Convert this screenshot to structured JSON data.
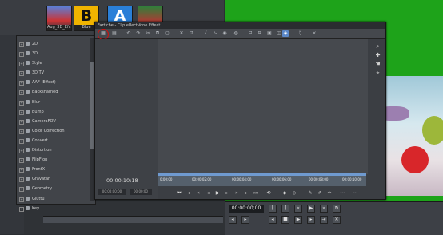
{
  "bin": {
    "thumbs": [
      {
        "caption": "Aug_3D_Efct..."
      },
      {
        "letter": "B",
        "caption": "Blue"
      },
      {
        "letter": "A",
        "caption": ""
      },
      {
        "caption": ""
      }
    ]
  },
  "effects": {
    "items": [
      "2D",
      "3D",
      "Style",
      "3D TV",
      "AAF (Effect)",
      "Backsharned",
      "Blur",
      "Bump",
      "CameraFOV",
      "Color Correction",
      "Convert",
      "Distortion",
      "FlipFlop",
      "FrontX",
      "Gravatar",
      "Geometry",
      "Gluttu",
      "Key"
    ]
  },
  "dialog": {
    "title": "Fartiche - Clip eRectVone Effect",
    "timecode": "00:00:10:18",
    "in_tc": "00:00:00:00",
    "out_tc": "00:00:00",
    "ruler_labels": [
      "0;00;00",
      "00;00;02;00",
      "00;00;04;00",
      "00;00;06;00",
      "00;00;08;00",
      "00;00;10;00"
    ]
  },
  "recorder": {
    "timecode": "00:00:00;00"
  },
  "colors": {
    "preview_green": "#1ea31a",
    "highlight": "#d21010",
    "accent": "#5b88c8"
  }
}
